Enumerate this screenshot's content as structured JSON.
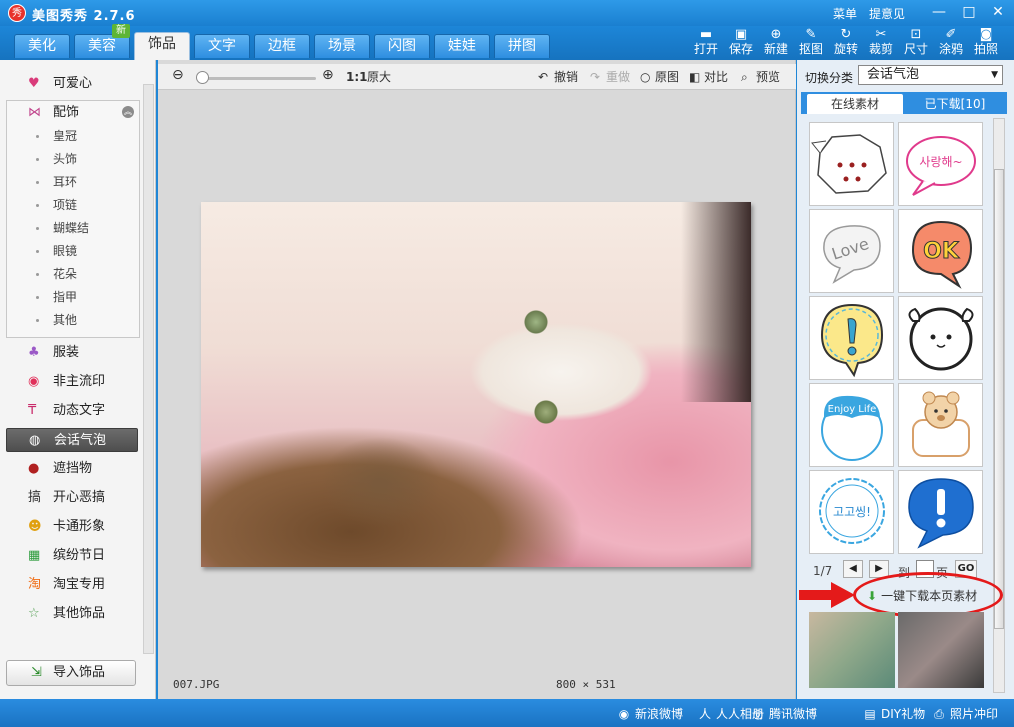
{
  "app": {
    "title": "美图秀秀 2.7.6",
    "logo": "秀",
    "menu": "菜单",
    "feedback": "提意见"
  },
  "window": {
    "minimize": "—",
    "maximize": "□",
    "close": "✕"
  },
  "tabs": [
    {
      "label": "美化"
    },
    {
      "label": "美容",
      "badge": "新"
    },
    {
      "label": "饰品"
    },
    {
      "label": "文字"
    },
    {
      "label": "边框"
    },
    {
      "label": "场景"
    },
    {
      "label": "闪图"
    },
    {
      "label": "娃娃"
    },
    {
      "label": "拼图"
    }
  ],
  "active_tab": "饰品",
  "tools": [
    {
      "label": "打开",
      "icon": "folder-icon"
    },
    {
      "label": "保存",
      "icon": "save-icon"
    },
    {
      "label": "新建",
      "icon": "new-icon"
    },
    {
      "label": "抠图",
      "icon": "cutout-icon"
    },
    {
      "label": "旋转",
      "icon": "rotate-icon"
    },
    {
      "label": "裁剪",
      "icon": "crop-icon"
    },
    {
      "label": "尺寸",
      "icon": "resize-icon"
    },
    {
      "label": "涂鸦",
      "icon": "brush-icon"
    },
    {
      "label": "拍照",
      "icon": "camera-icon"
    }
  ],
  "sidebar": {
    "items": [
      {
        "label": "可爱心",
        "icon": "heart-icon"
      },
      {
        "label": "配饰",
        "icon": "bow-icon"
      },
      {
        "label": "服装",
        "icon": "shirt-icon"
      },
      {
        "label": "非主流印",
        "icon": "lips-icon"
      },
      {
        "label": "动态文字",
        "icon": "text-anim-icon"
      },
      {
        "label": "会话气泡",
        "icon": "speech-bubble-icon"
      },
      {
        "label": "遮挡物",
        "icon": "mask-icon"
      },
      {
        "label": "开心恶搞",
        "icon": "fun-icon"
      },
      {
        "label": "卡通形象",
        "icon": "cartoon-icon"
      },
      {
        "label": "缤纷节日",
        "icon": "gift-icon"
      },
      {
        "label": "淘宝专用",
        "icon": "taobao-icon"
      },
      {
        "label": "其他饰品",
        "icon": "misc-icon"
      }
    ],
    "subitems": [
      "皇冠",
      "头饰",
      "耳环",
      "项链",
      "蝴蝶结",
      "眼镜",
      "花朵",
      "指甲",
      "其他"
    ],
    "active": "会话气泡",
    "import_label": "导入饰品"
  },
  "canvas_toolbar": {
    "zoom_ratio": "1:1",
    "original_size": "原大",
    "undo": "撤销",
    "redo": "重做",
    "original": "原图",
    "compare": "对比",
    "preview": "预览",
    "zoom_level": 0.0
  },
  "image": {
    "filename": "007.JPG",
    "dimensions": "800 × 531"
  },
  "right_panel": {
    "category_label": "切换分类",
    "category_value": "会话气泡",
    "tab_online": "在线素材",
    "tab_downloaded": "已下载[10]",
    "stickers": [
      {
        "name": "dotted-bubble"
      },
      {
        "name": "korean-bubble",
        "text": "사랑해~"
      },
      {
        "name": "love-bubble",
        "text": "Love"
      },
      {
        "name": "ok-bubble",
        "text": "OK"
      },
      {
        "name": "exclaim-yellow-bubble"
      },
      {
        "name": "face-bubble"
      },
      {
        "name": "enjoy-life-bubble",
        "text": "Enjoy Life"
      },
      {
        "name": "bear-bubble"
      },
      {
        "name": "blue-doodle-bubble",
        "text": "고고씽!"
      },
      {
        "name": "blue-exclaim-bubble"
      }
    ],
    "page": "1/7",
    "goto_label": "到",
    "page_unit": "页",
    "go_button": "GO",
    "download_page": "一键下载本页素材"
  },
  "bottom_links": [
    {
      "label": "新浪微博",
      "icon": "weibo-icon"
    },
    {
      "label": "人人相册",
      "icon": "renren-icon"
    },
    {
      "label": "腾讯微博",
      "icon": "tencent-icon"
    },
    {
      "label": "DIY礼物",
      "icon": "diy-gift-icon"
    },
    {
      "label": "照片冲印",
      "icon": "printer-icon"
    }
  ],
  "colors": {
    "accent": "#1f86d6",
    "highlight": "#e41a1a",
    "active_item": "#555555"
  }
}
